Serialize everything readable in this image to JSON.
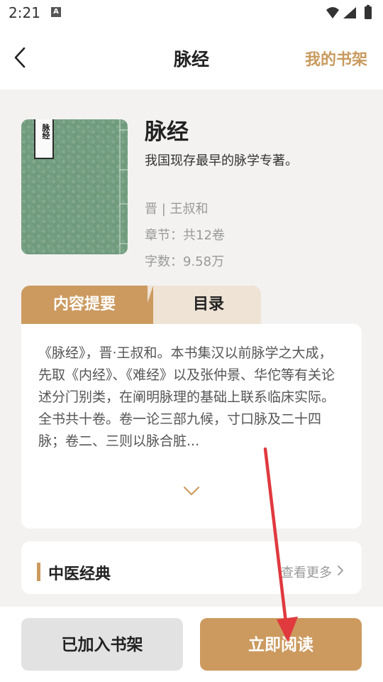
{
  "status": {
    "time": "2:21",
    "notif_letter": "A"
  },
  "nav": {
    "title": "脉经",
    "right_label": "我的书架"
  },
  "book": {
    "cover_label": "脉经",
    "title": "脉经",
    "description": "我国现存最早的脉学专著。",
    "author": "晋 | 王叔和",
    "chapters": "章节：共12卷",
    "words": "字数：9.58万"
  },
  "tabs": {
    "active": "内容提要",
    "inactive": "目录"
  },
  "intro": {
    "text": "《脉经》，晋·王叔和。本书集汉以前脉学之大成，先取《内经》、《难经》以及张仲景、华佗等有关论述分门别类，在阐明脉理的基础上联系临床实际。全书共十卷。卷一论三部九候，寸口脉及二十四脉；卷二、三则以脉合脏..."
  },
  "section": {
    "title": "中医经典",
    "more_label": "查看更多"
  },
  "bottom": {
    "shelf_label": "已加入书架",
    "read_label": "立即阅读"
  },
  "colors": {
    "accent": "#cc9a5f",
    "annotation_arrow": "#e0393e"
  },
  "icons": {
    "back": "chevron-left-icon",
    "expand": "chevron-down-icon",
    "more": "chevron-right-icon",
    "wifi": "wifi-icon",
    "signal": "signal-icon",
    "battery": "battery-icon"
  }
}
